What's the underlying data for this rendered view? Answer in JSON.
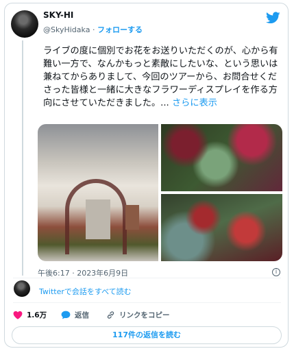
{
  "author": {
    "name": "SKY-HI",
    "handle": "@SkyHidaka",
    "separator": "·",
    "follow_label": "フォローする"
  },
  "tweet": {
    "text": "ライブの度に個別でお花をお送りいただくのが、心から有難い一方で、なんかもっと素敵にしたいな、という思いは兼ねてからありまして、今回のツアーから、お問合せくださった皆様と一緒に大きなフラワーディスプレイを作る方向にさせていただきました。...",
    "more_label": "さらに表示",
    "timestamp": "午後6:17 · 2023年6月9日"
  },
  "media": {
    "photos": [
      "flower-display-photo",
      "flowers-closeup-photo-1",
      "flowers-closeup-photo-2"
    ]
  },
  "thread": {
    "conversation_link": "Twitterで会話をすべて読む"
  },
  "actions": {
    "likes": "1.6万",
    "reply_label": "返信",
    "copy_link_label": "リンクをコピー"
  },
  "footer": {
    "read_replies_label": "117件の返信を読む"
  },
  "colors": {
    "accent": "#1d9bf0",
    "like": "#f91880",
    "text": "#0f1419",
    "secondary": "#536471"
  },
  "icons": [
    "twitter-bird-icon",
    "info-icon",
    "heart-icon",
    "reply-bubble-icon",
    "link-icon"
  ]
}
